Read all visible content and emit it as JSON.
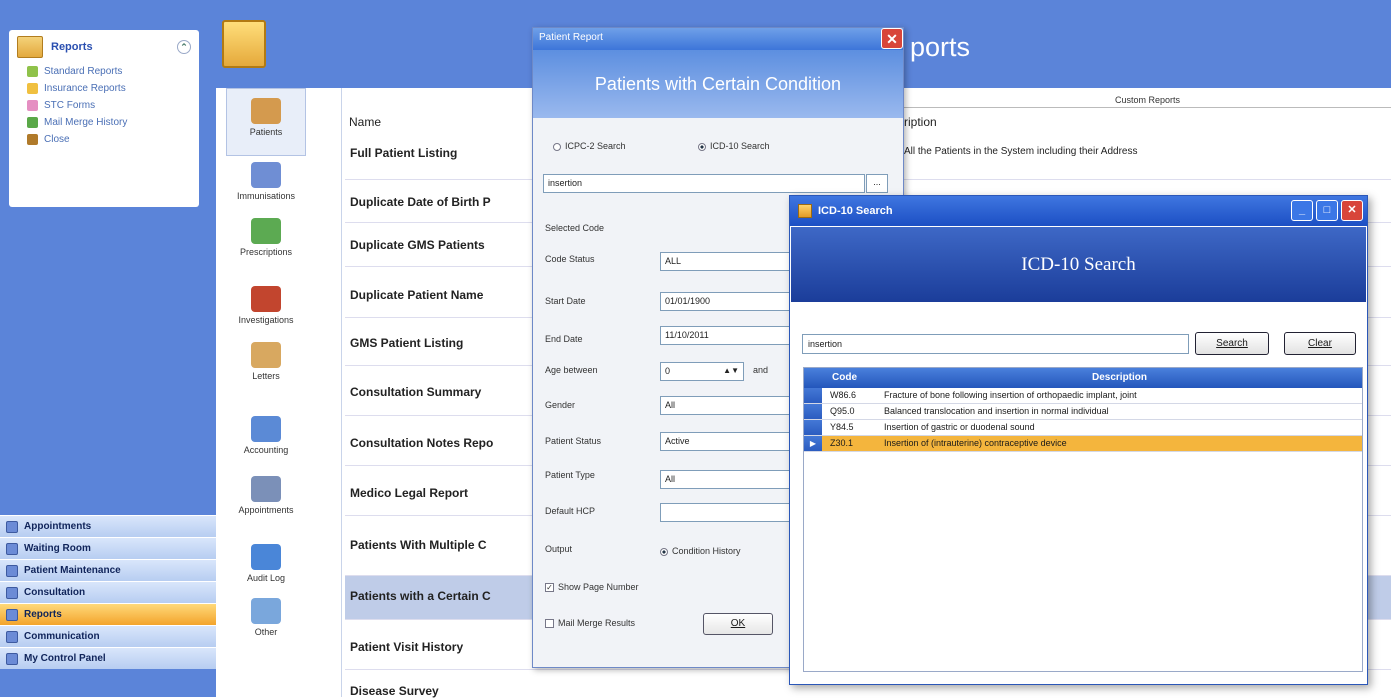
{
  "nav": {
    "panel_title": "Reports",
    "panel_items": [
      "Standard Reports",
      "Insurance Reports",
      "STC Forms",
      "Mail Merge History",
      "Close"
    ],
    "sections": [
      "Appointments",
      "Waiting Room",
      "Patient Maintenance",
      "Consultation",
      "Reports",
      "Communication",
      "My Control Panel"
    ],
    "active_section": "Reports"
  },
  "header": {
    "title": "ports"
  },
  "categories": [
    "Patients",
    "Immunisations",
    "Prescriptions",
    "Investigations",
    "Letters",
    "Accounting",
    "Appointments",
    "Audit Log",
    "Other"
  ],
  "table": {
    "group_header": "Custom Reports",
    "col_name": "Name",
    "col_desc": "ription",
    "rows": [
      {
        "name": "Full Patient Listing",
        "desc": "All the Patients in the System including their Address"
      },
      {
        "name": "Duplicate Date of Birth P",
        "desc": ""
      },
      {
        "name": "Duplicate GMS Patients",
        "desc": ""
      },
      {
        "name": "Duplicate Patient Name",
        "desc": ""
      },
      {
        "name": "GMS Patient Listing",
        "desc": ""
      },
      {
        "name": "Consultation Summary",
        "desc": ""
      },
      {
        "name": "Consultation Notes Repo",
        "desc": ""
      },
      {
        "name": "Medico Legal Report",
        "desc": ""
      },
      {
        "name": "Patients With Multiple C",
        "desc": ""
      },
      {
        "name": "Patients with a Certain C",
        "desc": ""
      },
      {
        "name": "Patient Visit History",
        "desc": ""
      },
      {
        "name": "Disease Survey",
        "desc": ""
      }
    ]
  },
  "patient_report": {
    "title": "Patient Report",
    "banner": "Patients with Certain Condition",
    "radio_icpc": "ICPC-2 Search",
    "radio_icd": "ICD-10 Search",
    "search_value": "insertion",
    "selected_code_label": "Selected Code",
    "code_status_label": "Code Status",
    "code_status_value": "ALL",
    "start_date_label": "Start Date",
    "start_date_value": "01/01/1900",
    "end_date_label": "End Date",
    "end_date_value": "11/10/2011",
    "age_label": "Age between",
    "age_from": "0",
    "age_and": "and",
    "gender_label": "Gender",
    "gender_value": "All",
    "patient_status_label": "Patient Status",
    "patient_status_value": "Active",
    "patient_type_label": "Patient Type",
    "patient_type_value": "All",
    "default_hcp_label": "Default HCP",
    "default_hcp_value": "",
    "output_label": "Output",
    "output_value": "Condition History",
    "show_page_number": "Show Page Number",
    "mail_merge": "Mail Merge Results",
    "ok_label": "OK"
  },
  "icd": {
    "title": "ICD-10 Search",
    "banner": "ICD-10 Search",
    "search_value": "insertion",
    "search_btn": "Search",
    "clear_btn": "Clear",
    "col_code": "Code",
    "col_desc": "Description",
    "rows": [
      {
        "code": "W86.6",
        "desc": "Fracture of bone following insertion of orthopaedic implant, joint"
      },
      {
        "code": "Q95.0",
        "desc": "Balanced translocation and insertion in normal individual"
      },
      {
        "code": "Y84.5",
        "desc": "Insertion of gastric or duodenal sound"
      },
      {
        "code": "Z30.1",
        "desc": "Insertion of (intrauterine) contraceptive device"
      }
    ],
    "selected_index": 3
  }
}
